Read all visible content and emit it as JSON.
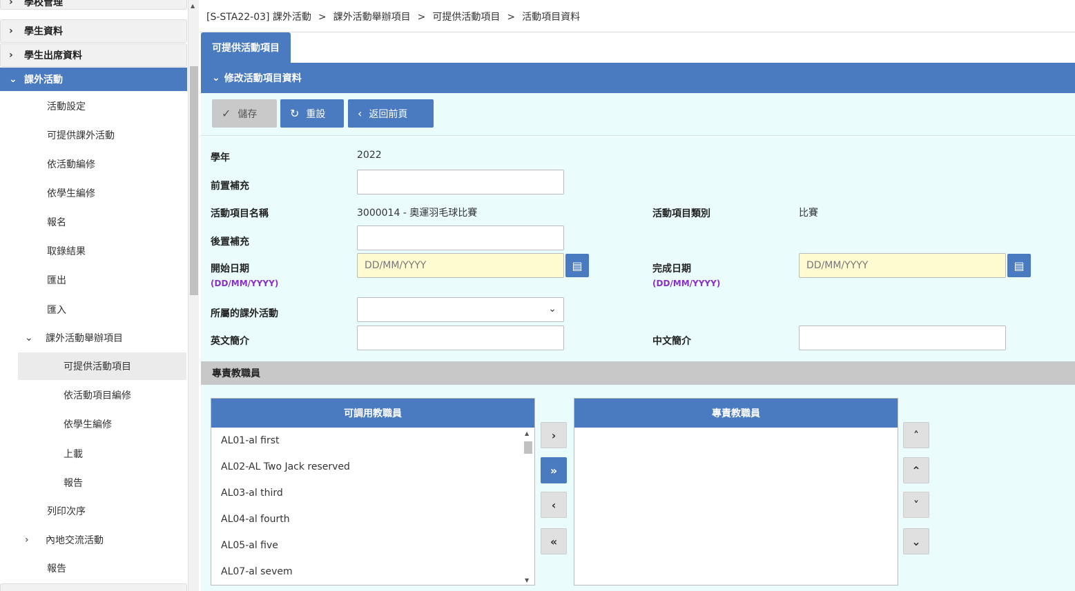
{
  "sidebar": {
    "top_partial": "學校管理",
    "heads": [
      {
        "label": "學生資料",
        "chev": "›"
      },
      {
        "label": "學生出席資料",
        "chev": "›"
      },
      {
        "label": "課外活動",
        "chev": "⌄"
      }
    ],
    "items": [
      {
        "label": "活動設定"
      },
      {
        "label": "可提供課外活動"
      },
      {
        "label": "依活動編修"
      },
      {
        "label": "依學生編修"
      },
      {
        "label": "報名"
      },
      {
        "label": "取錄結果"
      },
      {
        "label": "匯出"
      },
      {
        "label": "匯入"
      },
      {
        "label": "課外活動舉辦項目",
        "chev": "⌄"
      },
      {
        "label": "可提供活動項目"
      },
      {
        "label": "依活動項目編修"
      },
      {
        "label": "依學生編修"
      },
      {
        "label": "上載"
      },
      {
        "label": "報告"
      },
      {
        "label": "列印次序"
      },
      {
        "label": "內地交流活動",
        "chev": "›"
      },
      {
        "label": "報告"
      }
    ]
  },
  "breadcrumb": [
    "[S-STA22-03] 課外活動",
    "課外活動舉辦項目",
    "可提供活動項目",
    "活動項目資料"
  ],
  "breadcrumb_sep": ">",
  "tab": "可提供活動項目",
  "section": {
    "title": "修改活動項目資料",
    "chev": "⌄"
  },
  "toolbar": {
    "save": {
      "label": "儲存",
      "icon": "✓"
    },
    "reset": {
      "label": "重設",
      "icon": "↻"
    },
    "back": {
      "label": "返回前頁",
      "icon": "‹"
    }
  },
  "form": {
    "school_year": {
      "label": "學年",
      "value": "2022"
    },
    "prefix": {
      "label": "前置補充",
      "value": ""
    },
    "item_name": {
      "label": "活動項目名稱",
      "value": "3000014 - 奧運羽毛球比賽"
    },
    "item_type": {
      "label": "活動項目類別",
      "value": "比賽"
    },
    "suffix": {
      "label": "後置補充",
      "value": ""
    },
    "start_date": {
      "label": "開始日期",
      "format": "(DD/MM/YYYY)",
      "placeholder": "DD/MM/YYYY"
    },
    "end_date": {
      "label": "完成日期",
      "format": "(DD/MM/YYYY)",
      "placeholder": "DD/MM/YYYY"
    },
    "activity": {
      "label": "所屬的課外活動",
      "value": ""
    },
    "en_intro": {
      "label": "英文簡介",
      "value": ""
    },
    "zh_intro": {
      "label": "中文簡介",
      "value": ""
    }
  },
  "staff": {
    "section_title": "專責教職員",
    "available_title": "可調用教職員",
    "assigned_title": "專責教職員",
    "available": [
      "AL01-al first",
      "AL02-AL Two Jack reserved",
      "AL03-al third",
      "AL04-al fourth",
      "AL05-al five",
      "AL07-al sevem"
    ],
    "assigned": []
  },
  "colors": {
    "accent": "#4a7bc1",
    "panel": "#eafcfc",
    "date_bg": "#fdfbcf",
    "format_hint": "#8b2fc9"
  }
}
